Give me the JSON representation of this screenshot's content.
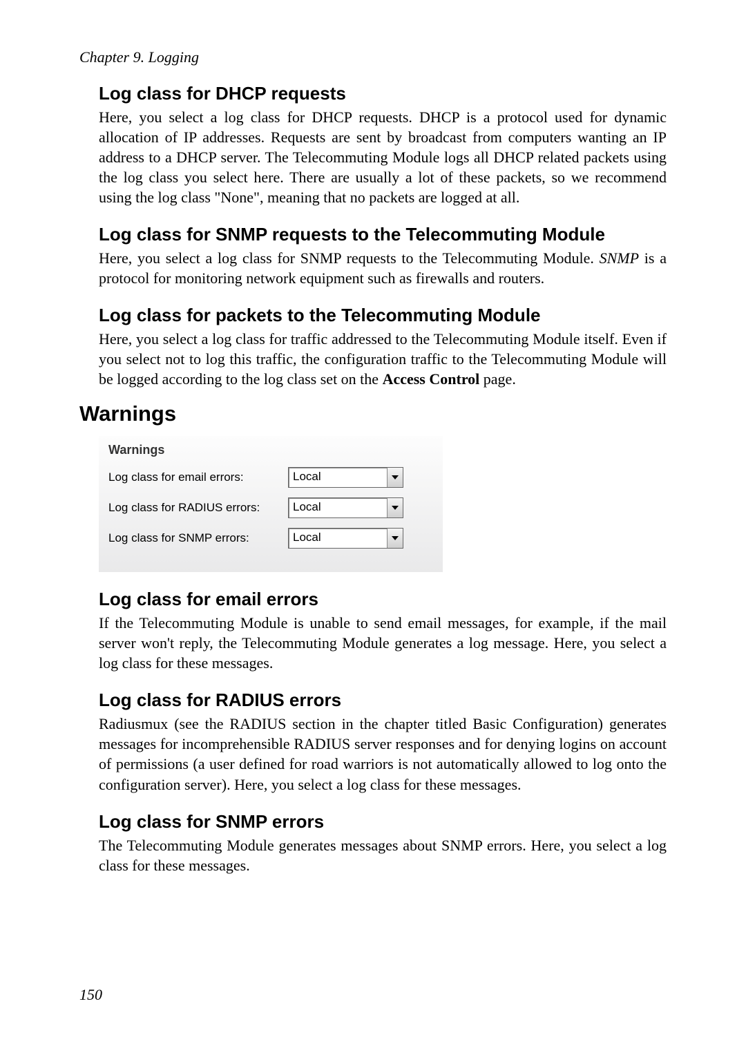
{
  "chapter_heading": "Chapter 9. Logging",
  "sections": {
    "dhcp": {
      "title": "Log class for DHCP requests",
      "body": "Here, you select a log class for DHCP requests. DHCP is a protocol used for dynamic allocation of IP addresses. Requests are sent by broadcast from computers wanting an IP address to a DHCP server. The Telecommuting Module logs all DHCP related packets using the log class you select here. There are usually a lot of these packets, so we recommend using the log class \"None\", meaning that no packets are logged at all."
    },
    "snmp": {
      "title": "Log class for SNMP requests to the Telecommuting Module",
      "body_pre": "Here, you select a log class for SNMP requests to the Telecommuting Module. ",
      "body_em": "SNMP",
      "body_post": " is a protocol for monitoring network equipment such as firewalls and routers."
    },
    "packets": {
      "title": "Log class for packets to the Telecommuting Module",
      "body_pre": "Here, you select a log class for traffic addressed to the Telecommuting Module itself. Even if you select not to log this traffic, the configuration traffic to the Telecommuting Module will be logged according to the log class set on the ",
      "body_bold": "Access Control",
      "body_post": " page."
    }
  },
  "warnings": {
    "heading": "Warnings",
    "panel_title": "Warnings",
    "rows": {
      "email": {
        "label": "Log class for email errors:",
        "value": "Local"
      },
      "radius": {
        "label": "Log class for RADIUS errors:",
        "value": "Local"
      },
      "snmp": {
        "label": "Log class for SNMP errors:",
        "value": "Local"
      }
    },
    "subsections": {
      "email": {
        "title": "Log class for email errors",
        "body": "If the Telecommuting Module is unable to send email messages, for example, if the mail server won't reply, the Telecommuting Module generates a log message. Here, you select a log class for these messages."
      },
      "radius": {
        "title": "Log class for RADIUS errors",
        "body": "Radiusmux (see the RADIUS section in the chapter titled Basic Configuration) generates messages for incomprehensible RADIUS server responses and for denying logins on account of permissions (a user defined for road warriors is not automatically allowed to log onto the configuration server). Here, you select a log class for these messages."
      },
      "snmp": {
        "title": "Log class for SNMP errors",
        "body": "The Telecommuting Module generates messages about SNMP errors. Here, you select a log class for these messages."
      }
    }
  },
  "page_number": "150"
}
